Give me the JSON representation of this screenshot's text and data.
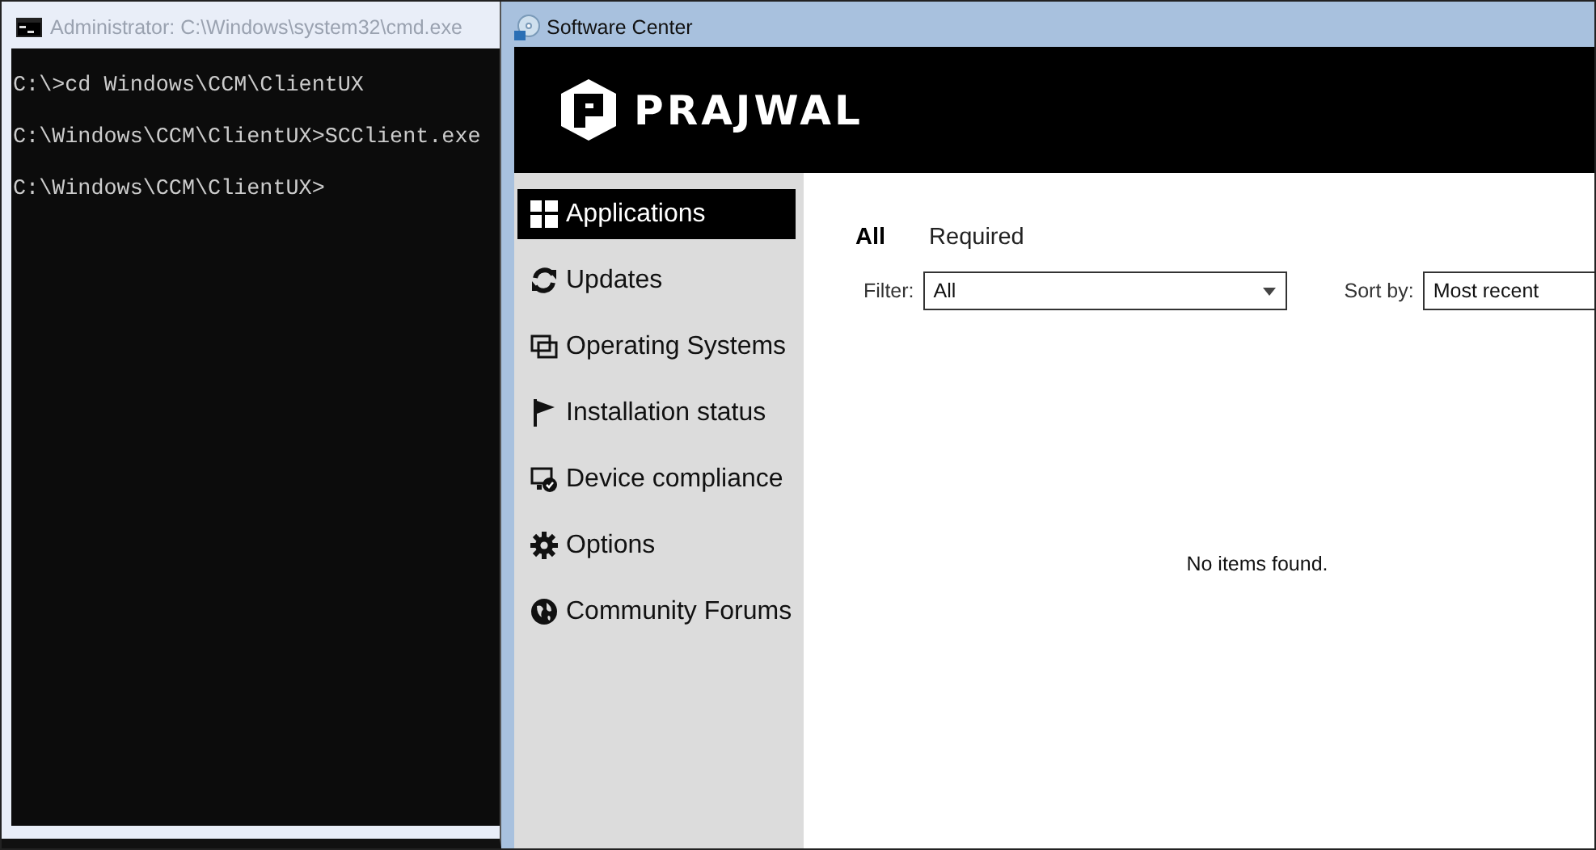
{
  "console_window": {
    "title": "Administrator: C:\\Windows\\system32\\cmd.exe",
    "lines": [
      "C:\\>cd Windows\\CCM\\ClientUX",
      "C:\\Windows\\CCM\\ClientUX>SCClient.exe",
      "C:\\Windows\\CCM\\ClientUX>"
    ]
  },
  "software_center": {
    "title": "Software Center",
    "brand": "PRAJWAL",
    "sidebar": {
      "items": [
        {
          "label": "Applications",
          "selected": true
        },
        {
          "label": "Updates",
          "selected": false
        },
        {
          "label": "Operating Systems",
          "selected": false
        },
        {
          "label": "Installation status",
          "selected": false
        },
        {
          "label": "Device compliance",
          "selected": false
        },
        {
          "label": "Options",
          "selected": false
        },
        {
          "label": "Community Forums",
          "selected": false
        }
      ]
    },
    "tabs": [
      {
        "label": "All",
        "selected": true
      },
      {
        "label": "Required",
        "selected": false
      }
    ],
    "filter": {
      "label": "Filter:",
      "value": "All"
    },
    "sort": {
      "label": "Sort by:",
      "value": "Most recent"
    },
    "empty_message": "No items found."
  }
}
